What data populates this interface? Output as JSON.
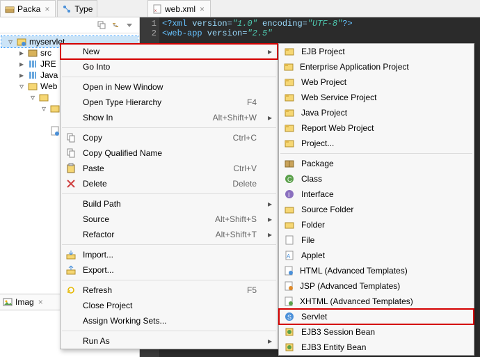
{
  "tabs": {
    "packa": "Packa",
    "type": "Type",
    "webxml": "web.xml"
  },
  "tree": {
    "root": "myservlet",
    "src": "src",
    "jre": "JRE",
    "java": "Java",
    "web": "Web"
  },
  "imag_tab": "Imag",
  "code": {
    "line1_a": "<?xml",
    "line1_b": " version=",
    "line1_c": "\"1.0\"",
    "line1_d": " encoding=",
    "line1_e": "\"UTF-8\"",
    "line1_f": "?>",
    "line2_a": "<web-app",
    "line2_b": " version=",
    "line2_c": "\"2.5\"",
    "ln1": "1",
    "ln2": "2"
  },
  "ctx": {
    "items": [
      {
        "label": "New",
        "sub": true,
        "highlight": true
      },
      {
        "label": "Go Into"
      },
      {
        "sep": true
      },
      {
        "label": "Open in New Window"
      },
      {
        "label": "Open Type Hierarchy",
        "accel": "F4"
      },
      {
        "label": "Show In",
        "accel": "Alt+Shift+W",
        "sub": true
      },
      {
        "sep": true
      },
      {
        "label": "Copy",
        "accel": "Ctrl+C",
        "icon": "copy"
      },
      {
        "label": "Copy Qualified Name",
        "icon": "copy"
      },
      {
        "label": "Paste",
        "accel": "Ctrl+V",
        "icon": "paste"
      },
      {
        "label": "Delete",
        "accel": "Delete",
        "icon": "delete"
      },
      {
        "sep": true
      },
      {
        "label": "Build Path",
        "sub": true
      },
      {
        "label": "Source",
        "accel": "Alt+Shift+S",
        "sub": true
      },
      {
        "label": "Refactor",
        "accel": "Alt+Shift+T",
        "sub": true
      },
      {
        "sep": true
      },
      {
        "label": "Import...",
        "icon": "import"
      },
      {
        "label": "Export...",
        "icon": "export"
      },
      {
        "sep": true
      },
      {
        "label": "Refresh",
        "accel": "F5",
        "icon": "refresh"
      },
      {
        "label": "Close Project"
      },
      {
        "label": "Assign Working Sets..."
      },
      {
        "sep": true
      },
      {
        "label": "Run As",
        "sub": true
      }
    ],
    "sub": [
      {
        "label": "EJB Project",
        "icon": "proj"
      },
      {
        "label": "Enterprise Application Project",
        "icon": "proj"
      },
      {
        "label": "Web Project",
        "icon": "proj"
      },
      {
        "label": "Web Service Project",
        "icon": "proj"
      },
      {
        "label": "Java Project",
        "icon": "proj"
      },
      {
        "label": "Report Web Project",
        "icon": "proj"
      },
      {
        "label": "Project...",
        "icon": "proj"
      },
      {
        "sep": true
      },
      {
        "label": "Package",
        "icon": "package"
      },
      {
        "label": "Class",
        "icon": "class"
      },
      {
        "label": "Interface",
        "icon": "interface"
      },
      {
        "label": "Source Folder",
        "icon": "folder"
      },
      {
        "label": "Folder",
        "icon": "folder"
      },
      {
        "label": "File",
        "icon": "file"
      },
      {
        "label": "Applet",
        "icon": "applet"
      },
      {
        "label": "HTML (Advanced Templates)",
        "icon": "html"
      },
      {
        "label": "JSP (Advanced Templates)",
        "icon": "jsp"
      },
      {
        "label": "XHTML (Advanced Templates)",
        "icon": "xhtml"
      },
      {
        "label": "Servlet",
        "icon": "servlet",
        "highlight": true
      },
      {
        "label": "EJB3 Session Bean",
        "icon": "bean"
      },
      {
        "label": "EJB3 Entity Bean",
        "icon": "bean"
      }
    ]
  }
}
